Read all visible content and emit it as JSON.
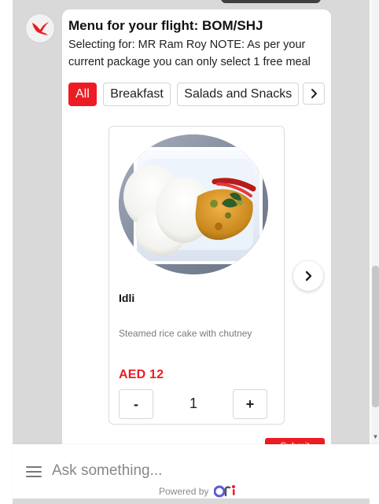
{
  "chat": {
    "menu_title": "Menu for your flight: BOM/SHJ",
    "menu_subtitle": "Selecting for: MR Ram Roy NOTE: As per your current package you can only select 1 free meal",
    "filters": [
      {
        "label": "All",
        "active": true
      },
      {
        "label": "Breakfast",
        "active": false
      },
      {
        "label": "Salads and Snacks",
        "active": false
      }
    ],
    "card": {
      "name": "Idli",
      "description": "Steamed rice cake with chutney",
      "price": "AED 12",
      "quantity": "1",
      "minus_label": "-",
      "plus_label": "+"
    },
    "submit_label": "Submit"
  },
  "input": {
    "placeholder": "Ask something..."
  },
  "footer": {
    "powered_by": "Powered by",
    "brand": "Ori"
  },
  "colors": {
    "accent": "#ed1c24",
    "bubble": "#ffffff",
    "chat_background": "#d9d9d9",
    "muted_text": "#7b7b7b"
  },
  "icons": {
    "avatar": "bird-icon",
    "filter_next": "chevron-right-icon",
    "carousel_next": "chevron-right-icon",
    "input_menu": "menu-lines-icon",
    "footer_logo": "ori-logo"
  }
}
